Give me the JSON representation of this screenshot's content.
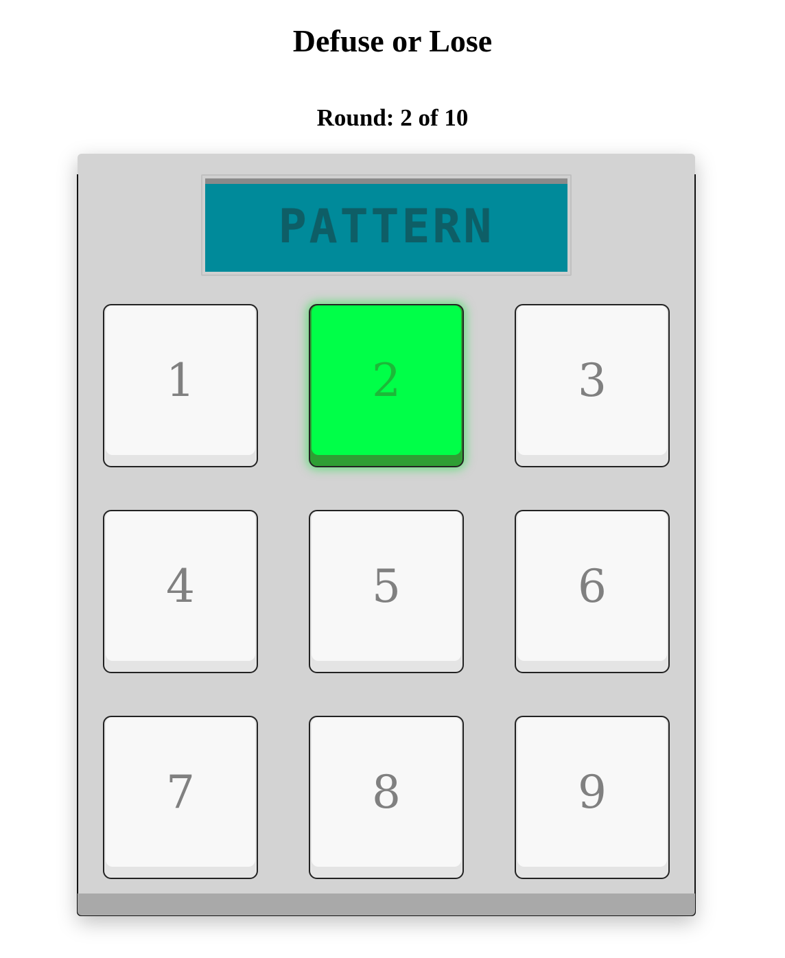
{
  "header": {
    "title": "Defuse or Lose",
    "round_text": "Round: 2 of 10"
  },
  "display": {
    "text": "PATTERN"
  },
  "keypad": {
    "active_key": "2",
    "keys": [
      {
        "label": "1"
      },
      {
        "label": "2"
      },
      {
        "label": "3"
      },
      {
        "label": "4"
      },
      {
        "label": "5"
      },
      {
        "label": "6"
      },
      {
        "label": "7"
      },
      {
        "label": "8"
      },
      {
        "label": "9"
      }
    ]
  },
  "colors": {
    "display_bg": "#008a9a",
    "display_text": "#0e5e66",
    "active_key": "#00ff48",
    "key_face": "#f8f8f8",
    "device_body": "#d3d3d3"
  }
}
